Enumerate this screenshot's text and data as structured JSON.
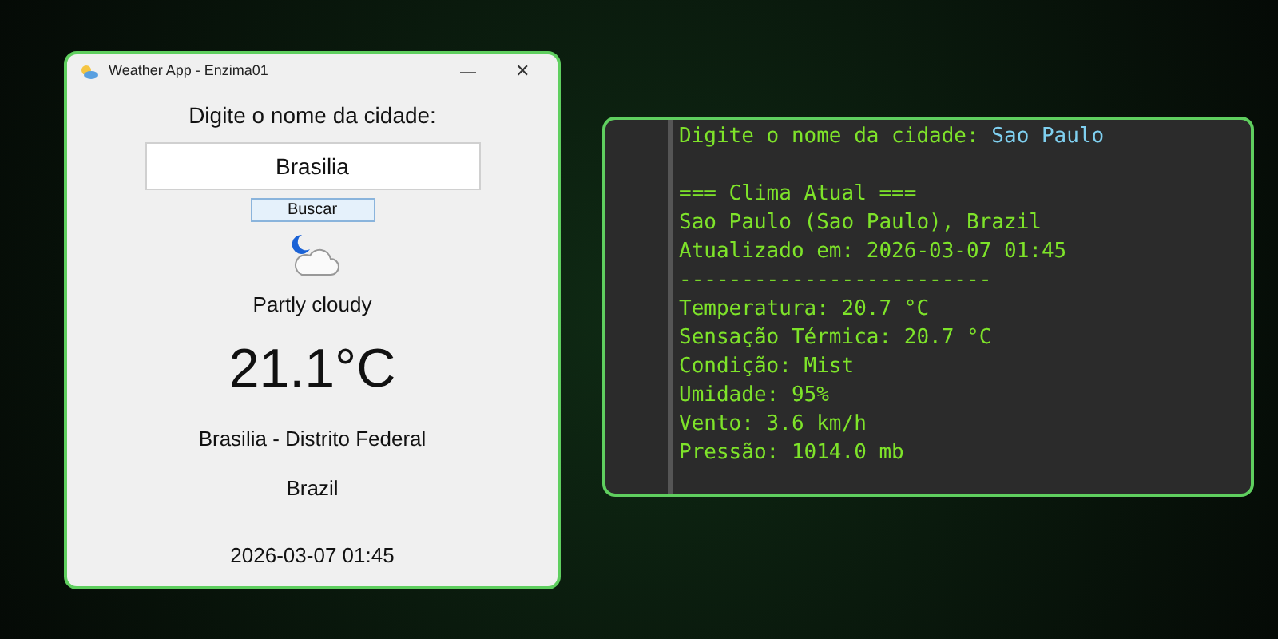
{
  "window": {
    "title": "Weather App - Enzima01",
    "minimize": "—",
    "close": "✕"
  },
  "form": {
    "label": "Digite o nome da cidade:",
    "city_value": "Brasilia",
    "button": "Buscar"
  },
  "weather": {
    "condition": "Partly cloudy",
    "temperature": "21.1°C",
    "location": "Brasilia - Distrito Federal",
    "country": "Brazil",
    "updated": "2026-03-07 01:45"
  },
  "console": {
    "prompt": "Digite o nome da cidade: ",
    "input": "Sao Paulo",
    "lines": [
      "=== Clima Atual ===",
      "Sao Paulo (Sao Paulo), Brazil",
      "Atualizado em: 2026-03-07 01:45",
      "-------------------------",
      "Temperatura: 20.7 °C",
      "Sensação Térmica: 20.7 °C",
      "Condição: Mist",
      "Umidade: 95%",
      "Vento: 3.6 km/h",
      "Pressão: 1014.0 mb"
    ]
  }
}
